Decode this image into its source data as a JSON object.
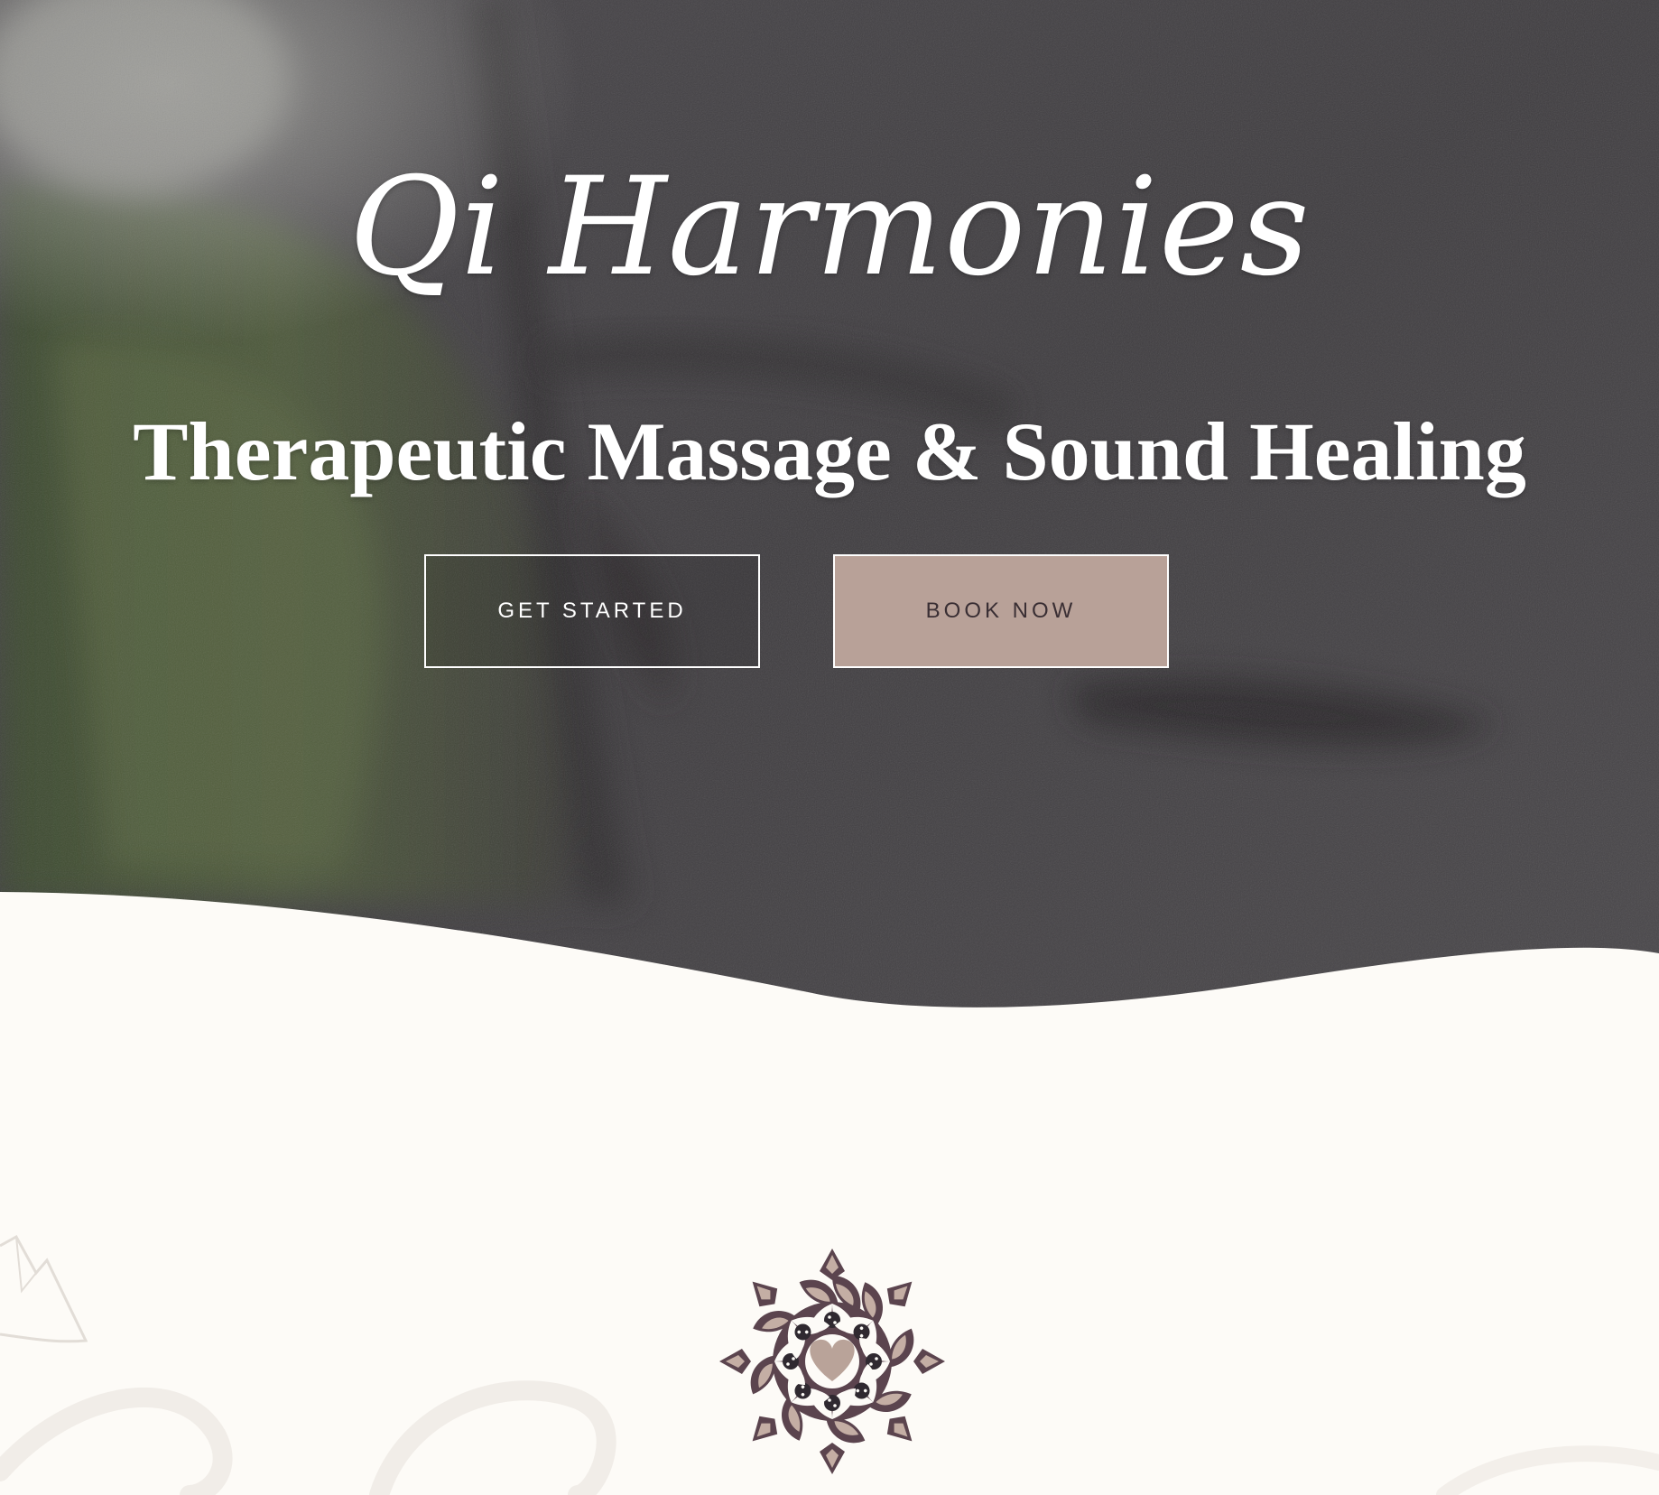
{
  "hero": {
    "title": "Qi Harmonies",
    "subtitle": "Therapeutic Massage & Sound Healing",
    "buttons": {
      "get_started": "GET STARTED",
      "book_now": "BOOK NOW"
    }
  },
  "colors": {
    "hero_overlay": "#545052",
    "background_cream": "#fdfbf7",
    "book_now_fill": "#b8a198",
    "book_now_text": "#3a2f34",
    "mandala_dark": "#5b444e",
    "mandala_light": "#c4aea4",
    "mandala_heart": "#b9a399"
  },
  "icons": {
    "logo": "mandala-heart-icon",
    "decoration": "mountain-outline-icon"
  }
}
